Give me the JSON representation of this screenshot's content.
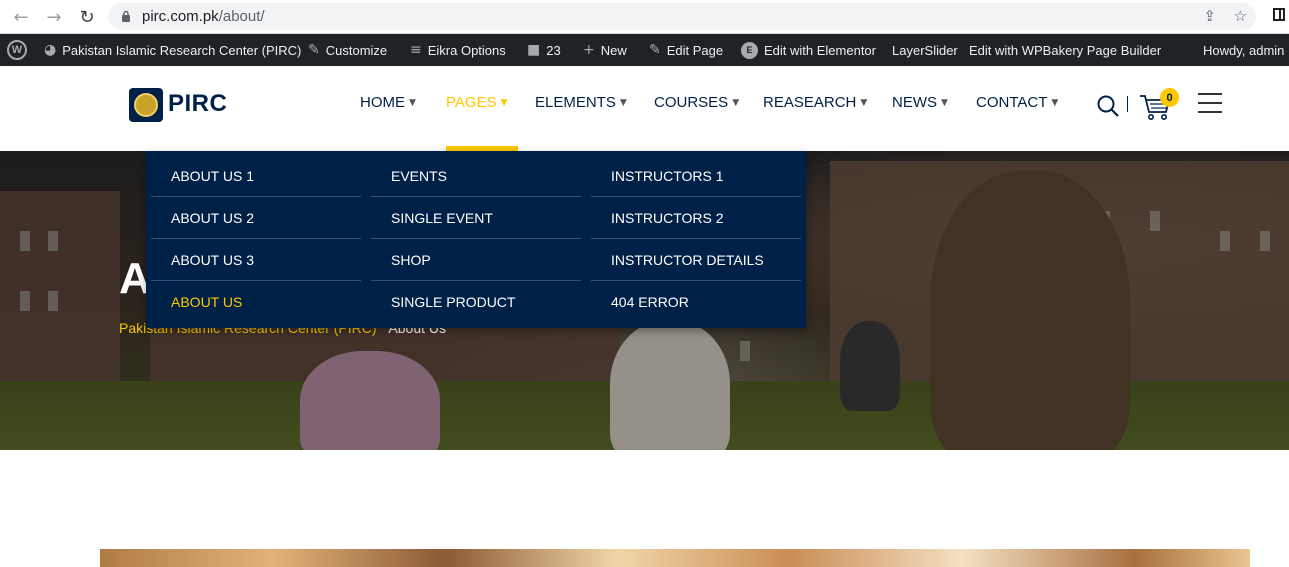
{
  "browser": {
    "url_host": "pirc.com.pk",
    "url_path": "/about/",
    "icons": [
      "back-arrow-icon",
      "forward-arrow-icon",
      "reload-icon",
      "lock-icon",
      "share-icon",
      "star-icon",
      "side-panel-icon"
    ]
  },
  "adminbar": {
    "site_name": "Pakistan Islamic Research Center (PIRC)",
    "customize": "Customize",
    "eikra_options": "Eikra Options",
    "comments_count": "23",
    "new": "New",
    "edit_page": "Edit Page",
    "edit_elementor": "Edit with Elementor",
    "layerslider": "LayerSlider",
    "wpbakery": "Edit with WPBakery Page Builder",
    "howdy": "Howdy, admin"
  },
  "header": {
    "logo_text": "PIRC",
    "menu": [
      {
        "label": "HOME",
        "active": false
      },
      {
        "label": "PAGES",
        "active": true
      },
      {
        "label": "ELEMENTS",
        "active": false
      },
      {
        "label": "COURSES",
        "active": false
      },
      {
        "label": "REASEARCH",
        "active": false
      },
      {
        "label": "NEWS",
        "active": false
      },
      {
        "label": "CONTACT",
        "active": false
      }
    ],
    "cart_count": "0"
  },
  "dropdown": {
    "columns": [
      [
        "ABOUT US 1",
        "ABOUT US 2",
        "ABOUT US 3",
        "ABOUT US"
      ],
      [
        "EVENTS",
        "SINGLE EVENT",
        "SHOP",
        "SINGLE PRODUCT"
      ],
      [
        "INSTRUCTORS 1",
        "INSTRUCTORS 2",
        "INSTRUCTOR DETAILS",
        "404 ERROR"
      ]
    ],
    "active_item": "ABOUT US"
  },
  "hero": {
    "title": "A",
    "breadcrumb_home": "Pakistan Islamic Research Center (PIRC)",
    "breadcrumb_current": "About Us"
  },
  "colors": {
    "brand_navy": "#002147",
    "accent_yellow": "#fdc800",
    "adminbar_bg": "#1d2327"
  }
}
